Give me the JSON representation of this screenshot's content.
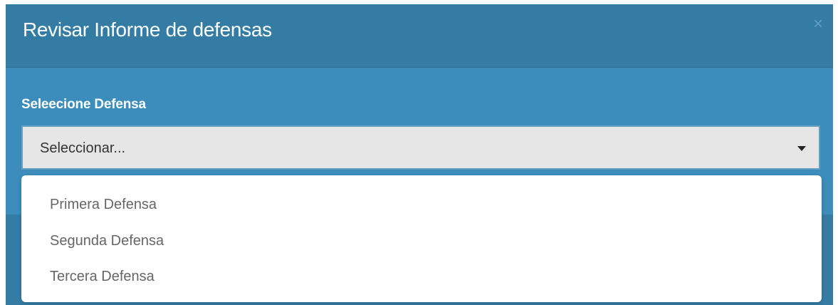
{
  "modal": {
    "title": "Revisar Informe de defensas",
    "close_label": "×"
  },
  "form": {
    "label": "Seleecione Defensa",
    "select": {
      "selected_value": "Seleccionar...",
      "arrow_icon": "caret-down-icon"
    }
  },
  "dropdown": {
    "options": [
      "Primera Defensa",
      "Segunda Defensa",
      "Tercera Defensa"
    ]
  },
  "colors": {
    "header": "#357ca5",
    "body": "#3c8dbc",
    "select_bg": "#e6e6e6",
    "menu_bg": "#ffffff",
    "option_text": "#666666"
  }
}
